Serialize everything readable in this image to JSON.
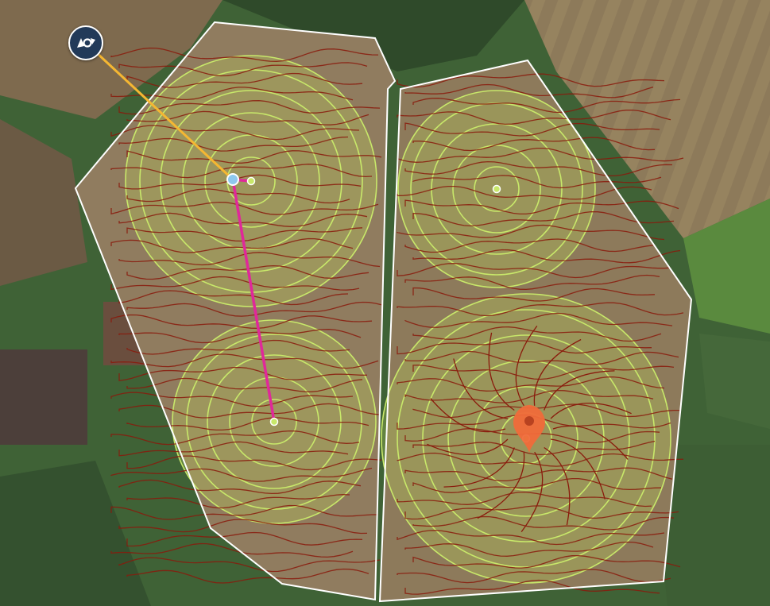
{
  "map": {
    "colors": {
      "boundary": "#ffffff",
      "ring": "#c8e86a",
      "ring_fill": "rgba(190,220,90,0.28)",
      "contour": "#8a1a0c",
      "hose": "#e0289a",
      "cable": "#f5b732",
      "base_marker": "#8ec8ee",
      "location_pin": "#f06a3a",
      "badge_bg": "#223a59"
    },
    "icons": {
      "badge": "camera-rotate-icon",
      "pin": "map-pin-icon"
    }
  }
}
